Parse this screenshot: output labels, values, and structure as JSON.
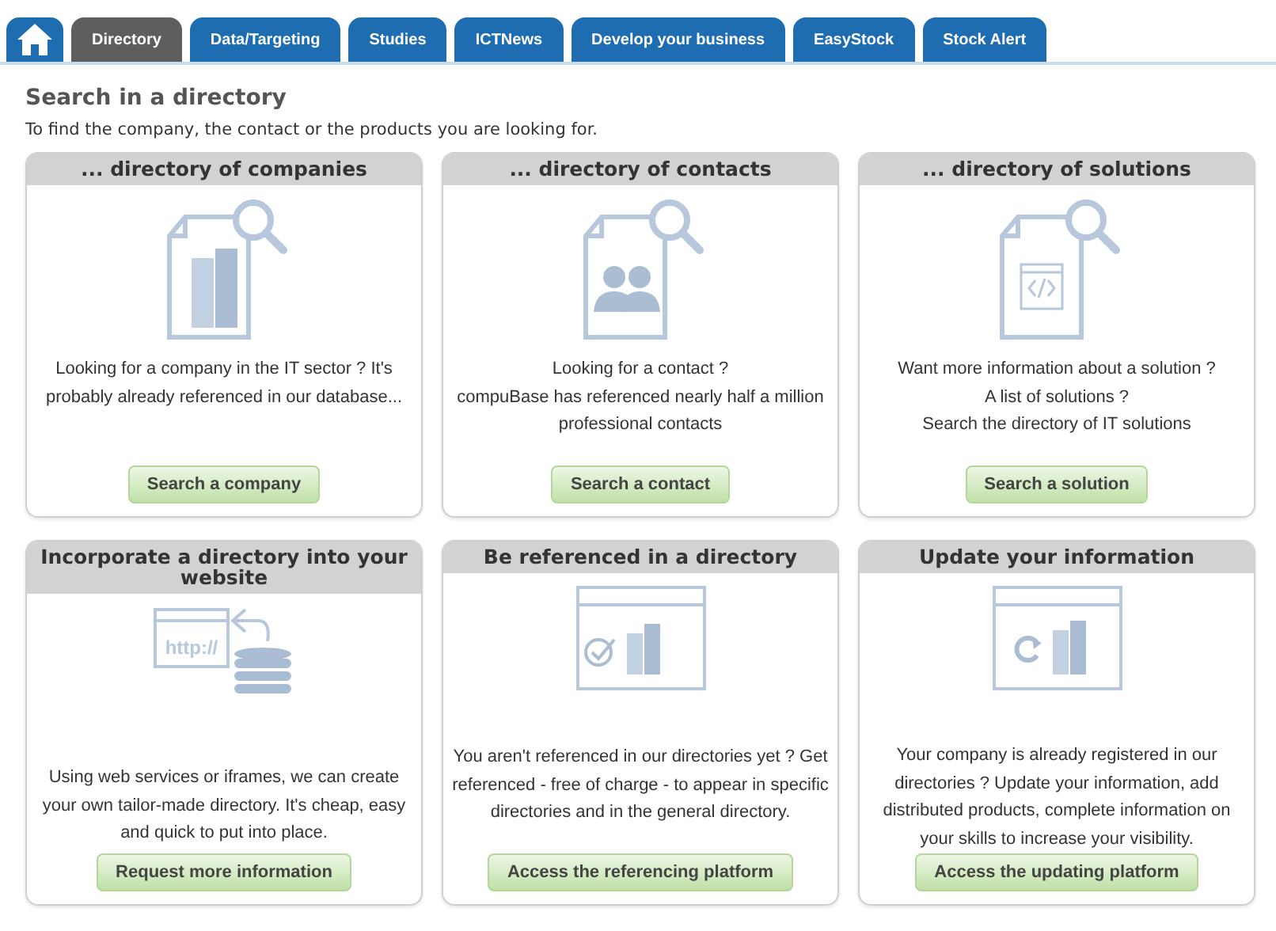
{
  "tabs": [
    {
      "kind": "home",
      "selected": false
    },
    {
      "kind": "text",
      "label": "Directory",
      "selected": true
    },
    {
      "kind": "text",
      "label": "Data/Targeting",
      "selected": false
    },
    {
      "kind": "text",
      "label": "Studies",
      "selected": false
    },
    {
      "kind": "text",
      "label": "ICTNews",
      "selected": false
    },
    {
      "kind": "text",
      "label": "Develop your business",
      "selected": false
    },
    {
      "kind": "text",
      "label": "EasyStock",
      "selected": false
    },
    {
      "kind": "text",
      "label": "Stock Alert",
      "selected": false
    }
  ],
  "page": {
    "title": "Search in a directory",
    "subtitle": "To find the company, the contact or the products you are looking for."
  },
  "cards": [
    {
      "title": "... directory of companies",
      "kind": "companies",
      "description": "Looking for a company in the IT sector ? It's probably already referenced in our database...",
      "button": "Search a company"
    },
    {
      "title": "... directory of contacts",
      "kind": "contacts",
      "description": "Looking for a contact ?\ncompuBase has referenced nearly half a million professional contacts",
      "button": "Search a contact"
    },
    {
      "title": "... directory of solutions",
      "kind": "solutions",
      "description": "Want more information about a solution ?\nA list of solutions ?\nSearch the directory of IT solutions",
      "button": "Search a solution"
    },
    {
      "title": "Incorporate a directory into your website",
      "kind": "http",
      "icon_text": "http://",
      "description": "Using web services or iframes, we can create your own tailor-made directory. It's cheap, easy and quick to put into place.",
      "button": "Request more information"
    },
    {
      "title": "Be referenced in a directory",
      "kind": "referenced",
      "description": "You aren't referenced in our directories yet ? Get referenced - free of charge - to appear in specific directories and in the general directory.",
      "button": "Access the referencing platform"
    },
    {
      "title": "Update your information",
      "kind": "update",
      "description": "Your company is already registered in our directories ? Update your information, add distributed products, complete information on your skills to increase your visibility.",
      "button": "Access the updating platform"
    }
  ]
}
